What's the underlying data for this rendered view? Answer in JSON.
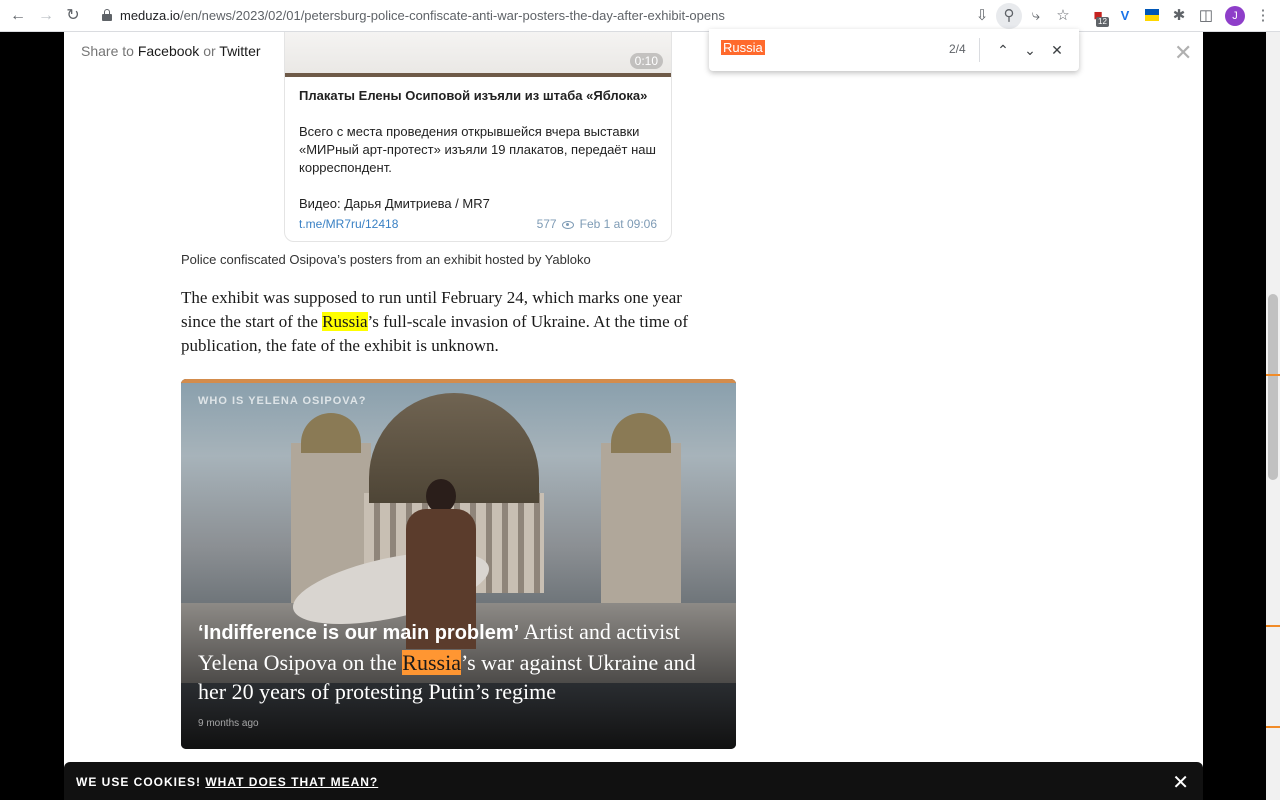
{
  "browser": {
    "url_host": "meduza.io",
    "url_path": "/en/news/2023/02/01/petersburg-police-confiscate-anti-war-posters-the-day-after-exhibit-opens",
    "avatar_letter": "J",
    "ext_badge": "12"
  },
  "find": {
    "query": "Russia",
    "count": "2/4"
  },
  "share": {
    "prefix": "Share to",
    "facebook": "Facebook",
    "or": "or",
    "twitter": "Twitter"
  },
  "telegram": {
    "duration": "0:10",
    "title": "Плакаты Елены Осиповой изъяли из штаба «Яблока»",
    "body": "Всего с места проведения открывшейся вчера выставки «МИРный арт-протест» изъяли 19 плакатов, передаёт наш корреспондент.",
    "credit": "Видео: Дарья Дмитриева / MR7",
    "link": "t.me/MR7ru/12418",
    "views": "577",
    "date": "Feb 1 at 09:06"
  },
  "caption": "Police confiscated Osipova’s posters from an exhibit hosted by Yabloko",
  "paragraph": {
    "before": "The exhibit was supposed to run until February 24, which marks one year since the start of the ",
    "highlight": "Russia",
    "after": "’s full-scale invasion of Ukraine. At the time of publication, the fate of the exhibit is unknown."
  },
  "related": {
    "kicker": "WHO IS YELENA OSIPOVA?",
    "title_bold": "‘Indifference is our main problem’",
    "title_before": " Artist and activist Yelena Osipova on the ",
    "title_highlight": "Russia",
    "title_after": "’s war against Ukraine and her 20 years of protesting Putin’s regime",
    "time": "9 months ago"
  },
  "cookie": {
    "text": "WE USE COOKIES!",
    "link": "WHAT DOES THAT MEAN?"
  },
  "colors": {
    "find_current": "#ff9632",
    "find_other": "#ffff00"
  }
}
